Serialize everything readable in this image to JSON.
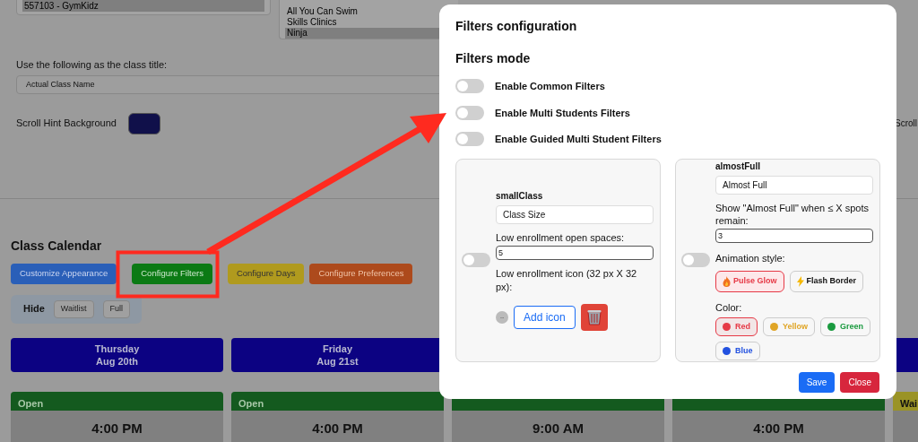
{
  "background": {
    "list_left": {
      "items": [
        {
          "label": "557103 - GymKidz",
          "selected": true
        }
      ]
    },
    "list_right": {
      "items": [
        {
          "label": "All You Can Swim",
          "selected": false
        },
        {
          "label": "Skills Clinics",
          "selected": false
        },
        {
          "label": "Ninja",
          "selected": true
        }
      ]
    },
    "class_title": {
      "label": "Use the following as the class title:",
      "value": "Actual Class Name"
    },
    "scroll_hint": {
      "label": "Scroll Hint Background",
      "color": "#10104a"
    },
    "right_label": "Scroll",
    "calendar": {
      "title": "Class Calendar",
      "buttons": [
        {
          "label": "Customize Appearance",
          "color": "#2a5fb8"
        },
        {
          "label": "Configure Filters",
          "color": "#0b7a14"
        },
        {
          "label": "Configure Days",
          "color": "#b09a1e"
        },
        {
          "label": "Configure Preferences",
          "color": "#ad4a1c"
        }
      ],
      "hide": {
        "label": "Hide",
        "options": [
          "Waitlist",
          "Full"
        ]
      },
      "columns": [
        {
          "weekday": "Thursday",
          "date": "Aug 20th",
          "status": "Open",
          "time": "4:00 PM"
        },
        {
          "weekday": "Friday",
          "date": "Aug 21st",
          "status": "Open",
          "time": "4:00 PM"
        },
        {
          "time": "9:00 AM"
        },
        {
          "time": "4:00 PM"
        },
        {
          "status": "Wai"
        }
      ]
    }
  },
  "modal": {
    "title": "Filters configuration",
    "subtitle": "Filters mode",
    "modes": [
      {
        "label": "Enable Common Filters",
        "on": false
      },
      {
        "label": "Enable Multi Students Filters",
        "on": false
      },
      {
        "label": "Enable Guided Multi Student Filters",
        "on": false
      }
    ],
    "panels": [
      {
        "kind": "small",
        "on": false,
        "name": "smallClass",
        "value": "Class Size",
        "field_label": "Low enrollment open spaces:",
        "field_value": "5",
        "icon_label": "Low enrollment icon (32 px X 32 px):",
        "placeholder_icon": "--",
        "add_label": "Add icon"
      },
      {
        "kind": "full",
        "on": false,
        "name": "almostFull",
        "value": "Almost Full",
        "field_label": "Show \"Almost Full\" when ≤ X spots remain:",
        "field_value": "3",
        "animation_label": "Animation style:",
        "animations": [
          {
            "kind": "flame",
            "label": "Pulse Glow",
            "selected": true
          },
          {
            "kind": "bolt",
            "label": "Flash Border",
            "selected": false
          }
        ],
        "color_label": "Color:",
        "colors": [
          {
            "label": "Red",
            "color": "#e63946",
            "selected": true
          },
          {
            "label": "Yellow",
            "color": "#e0a526",
            "selected": false
          },
          {
            "label": "Green",
            "color": "#1a9a3f",
            "selected": false
          },
          {
            "label": "Blue",
            "color": "#2251e0",
            "selected": false
          }
        ]
      }
    ],
    "buttons": [
      {
        "label": "Save",
        "color": "#1a6cf5"
      },
      {
        "label": "Close",
        "color": "#d7263d"
      }
    ]
  }
}
